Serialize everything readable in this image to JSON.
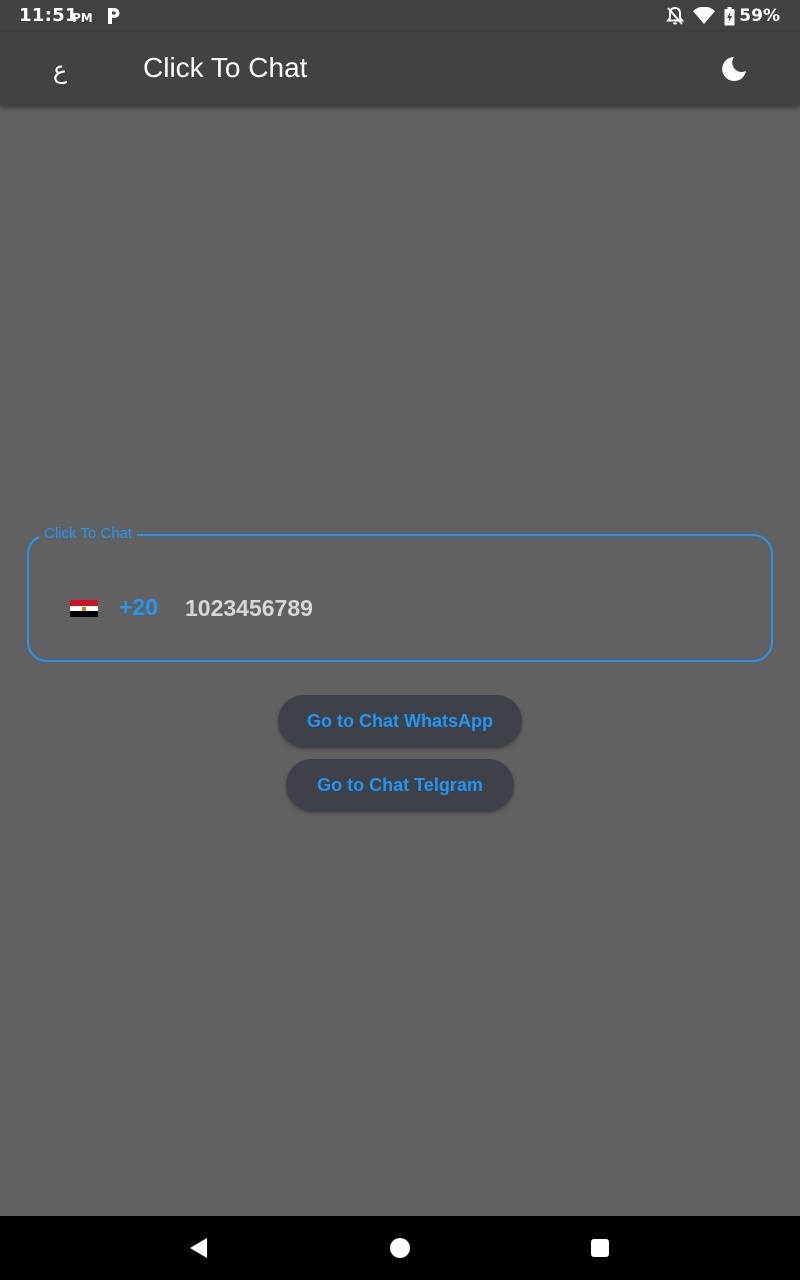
{
  "status_bar": {
    "time": "11:51",
    "ampm": "PM",
    "battery": "59%",
    "icons": [
      "parking-notification-icon",
      "notifications-off-icon",
      "wifi-icon",
      "battery-charging-icon"
    ]
  },
  "app_bar": {
    "language_toggle": "ع",
    "title": "Click To Chat",
    "theme_icon": "moon-icon"
  },
  "phone_field": {
    "label": "Click To Chat",
    "country_flag": "egypt-flag-icon",
    "country_code": "+20",
    "phone_number": "1023456789"
  },
  "buttons": {
    "whatsapp": "Go to Chat WhatsApp",
    "telegram": "Go to Chat Telgram"
  },
  "nav_bar": {
    "icons": [
      "back-icon",
      "home-icon",
      "recents-icon"
    ]
  },
  "colors": {
    "background": "#616161",
    "app_bar": "#424242",
    "accent": "#2196f3",
    "button_bg": "#3e4147"
  }
}
